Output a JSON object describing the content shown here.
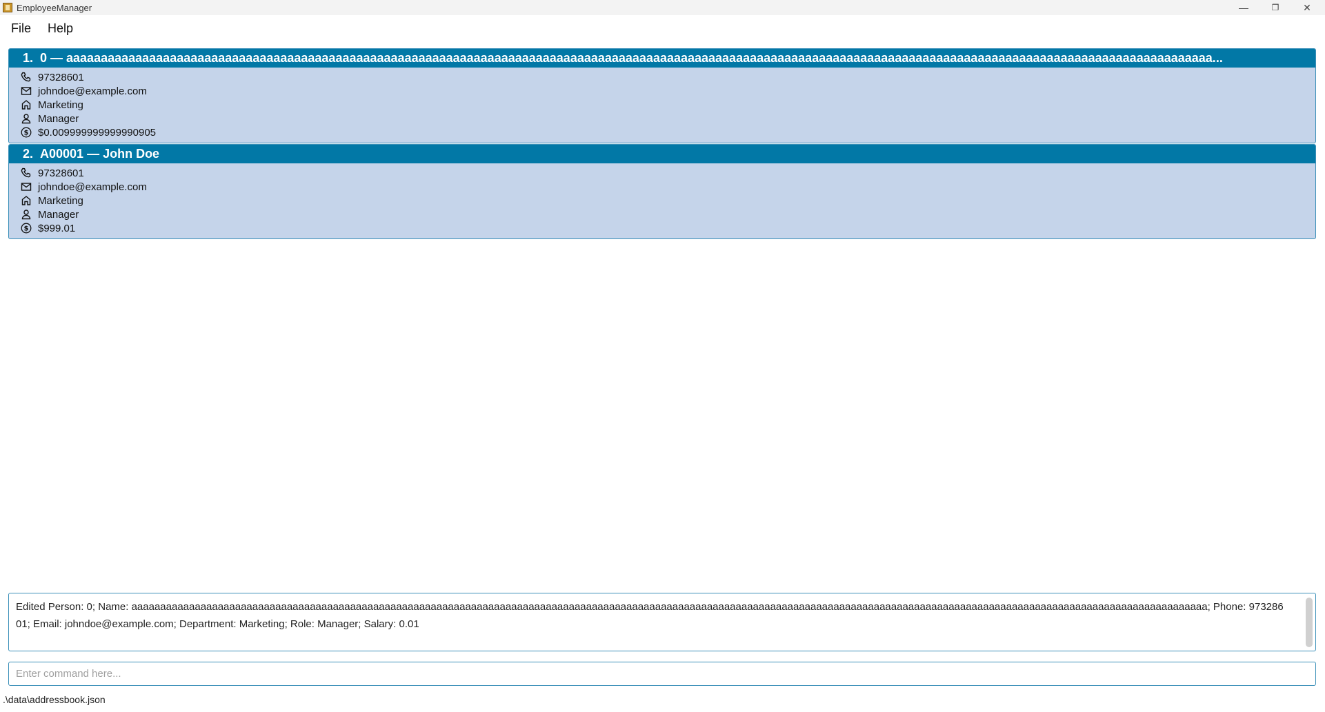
{
  "window": {
    "title": "EmployeeManager",
    "minimize": "—",
    "maximize": "❐",
    "close": "✕"
  },
  "menu": {
    "file": "File",
    "help": "Help"
  },
  "employees": [
    {
      "index": "1.",
      "header": "0 — aaaaaaaaaaaaaaaaaaaaaaaaaaaaaaaaaaaaaaaaaaaaaaaaaaaaaaaaaaaaaaaaaaaaaaaaaaaaaaaaaaaaaaaaaaaaaaaaaaaaaaaaaaaaaaaaaaaaaaaaaaaaaaaaaaaaaaaaaaaaaaaaaaaaaaaaaaaaaaaaaaaaaa...",
      "phone": "97328601",
      "email": "johndoe@example.com",
      "department": "Marketing",
      "role": "Manager",
      "salary": "$0.009999999999990905"
    },
    {
      "index": "2.",
      "header": "A00001 — John Doe",
      "phone": "97328601",
      "email": "johndoe@example.com",
      "department": "Marketing",
      "role": "Manager",
      "salary": "$999.01"
    }
  ],
  "result": {
    "text": "Edited Person: 0; Name: aaaaaaaaaaaaaaaaaaaaaaaaaaaaaaaaaaaaaaaaaaaaaaaaaaaaaaaaaaaaaaaaaaaaaaaaaaaaaaaaaaaaaaaaaaaaaaaaaaaaaaaaaaaaaaaaaaaaaaaaaaaaaaaaaaaaaaaaaaaaaaaaaaaaaaaaaaaaaaaaaaaaaaaaaaaaaaaaaaaaaaaaaaa; Phone: 97328601; Email: johndoe@example.com; Department: Marketing; Role: Manager; Salary: 0.01"
  },
  "command": {
    "placeholder": "Enter command here...",
    "value": ""
  },
  "status": {
    "path": ".\\data\\addressbook.json"
  }
}
